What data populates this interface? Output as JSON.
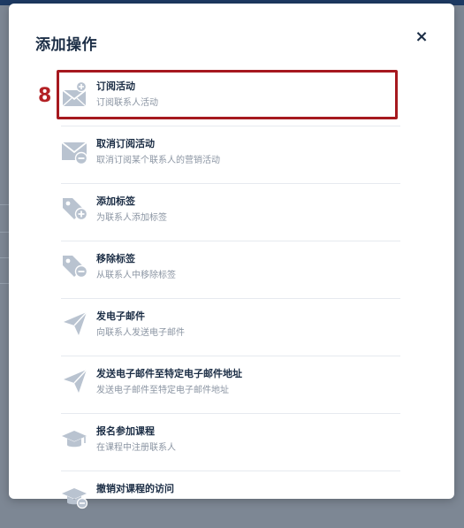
{
  "modal": {
    "title": "添加操作",
    "close_label": "×"
  },
  "annotation": {
    "step_number": "8"
  },
  "actions": [
    {
      "label": "订阅活动",
      "desc": "订阅联系人活动",
      "icon": "mail-subscribe-icon"
    },
    {
      "label": "取消订阅活动",
      "desc": "取消订阅某个联系人的营销活动",
      "icon": "mail-unsubscribe-icon"
    },
    {
      "label": "添加标签",
      "desc": "为联系人添加标签",
      "icon": "tag-add-icon"
    },
    {
      "label": "移除标签",
      "desc": "从联系人中移除标签",
      "icon": "tag-remove-icon"
    },
    {
      "label": "发电子邮件",
      "desc": "向联系人发送电子邮件",
      "icon": "paper-plane-icon"
    },
    {
      "label": "发送电子邮件至特定电子邮件地址",
      "desc": "发送电子邮件至特定电子邮件地址",
      "icon": "paper-plane-icon"
    },
    {
      "label": "报名参加课程",
      "desc": "在课程中注册联系人",
      "icon": "graduation-cap-icon"
    },
    {
      "label": "撤销对课程的访问",
      "desc": "",
      "icon": "graduation-cap-remove-icon"
    }
  ],
  "colors": {
    "icon": "#b9c3d0",
    "highlight": "#a6191f",
    "title": "#1b2d45",
    "subtitle": "#8b95a3"
  }
}
